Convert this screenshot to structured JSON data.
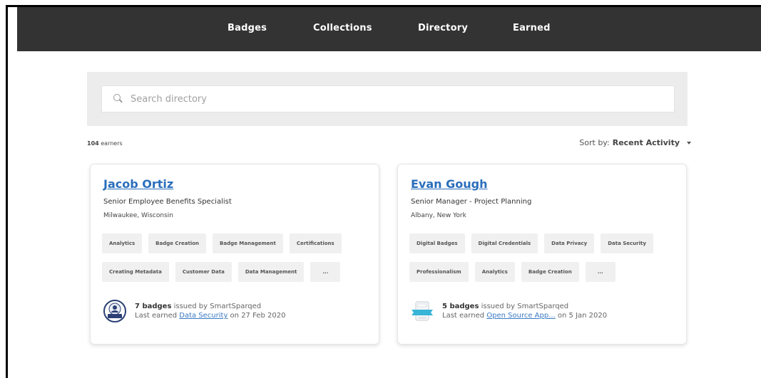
{
  "nav": {
    "items": [
      {
        "label": "Badges"
      },
      {
        "label": "Collections"
      },
      {
        "label": "Directory",
        "active": true
      },
      {
        "label": "Earned"
      }
    ]
  },
  "search": {
    "placeholder": "Search directory",
    "value": ""
  },
  "results": {
    "count_number": "104",
    "count_suffix": " earners"
  },
  "sort": {
    "label": "Sort by:",
    "value": "Recent Activity"
  },
  "earners": [
    {
      "name": "Jacob Ortiz",
      "title": "Senior Employee Benefits Specialist",
      "location": "Milwaukee, Wisconsin",
      "skills_row1": [
        "Analytics",
        "Badge Creation",
        "Badge Management",
        "Certifications"
      ],
      "skills_row2": [
        "Creating Metadata",
        "Customer Data",
        "Data Management"
      ],
      "more_label": "...",
      "badge_count": "7 badges",
      "issued_by": " issued by SmartSparqed",
      "last_earned_prefix": "Last earned ",
      "last_earned_badge": "Data Security",
      "last_earned_date": " on 27 Feb 2020",
      "badge_icon": "circle-badge-icon"
    },
    {
      "name": "Evan Gough",
      "title": "Senior Manager - Project Planning",
      "location": "Albany, New York",
      "skills_row1": [
        "Digital Badges",
        "Digital Credentials",
        "Data Privacy",
        "Data Security"
      ],
      "skills_row2": [
        "Professionalism",
        "Analytics",
        "Badge Creation"
      ],
      "more_label": "...",
      "badge_count": "5 badges",
      "issued_by": " issued by SmartSparqed",
      "last_earned_prefix": "Last earned ",
      "last_earned_badge": "Open Source App...",
      "last_earned_date": " on 5 Jan 2020",
      "badge_icon": "ribbon-badge-icon"
    }
  ],
  "colors": {
    "nav_bg": "#333333",
    "link": "#2a6ebb",
    "panel_bg": "#ececec"
  }
}
